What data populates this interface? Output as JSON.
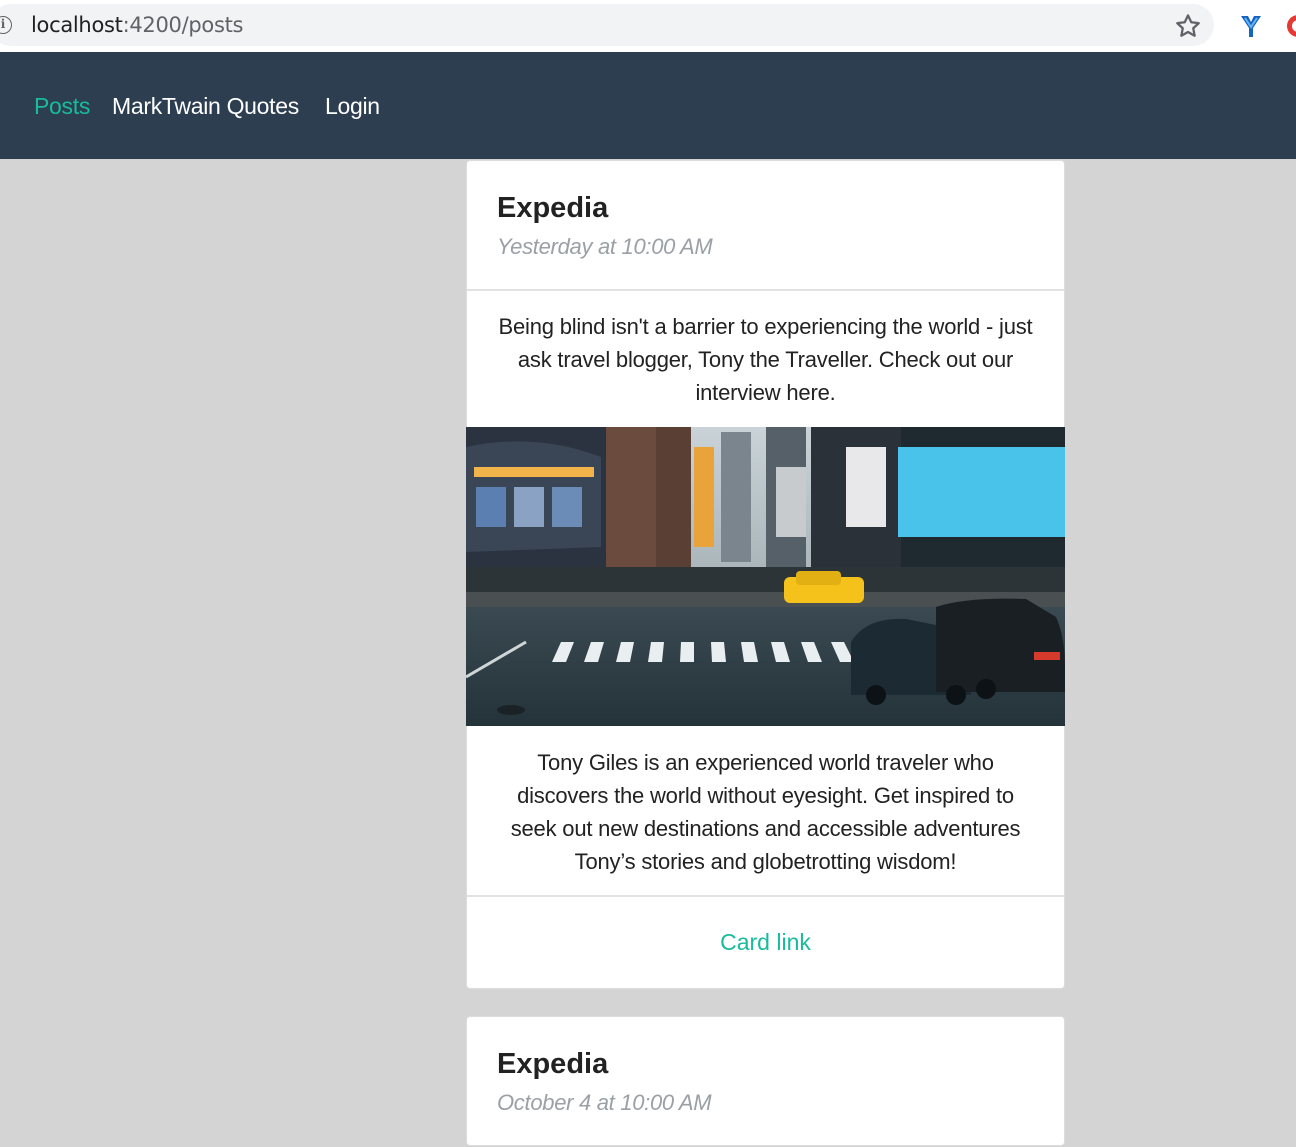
{
  "browser": {
    "url_host": "localhost",
    "url_path": ":4200/posts",
    "icons": [
      "info-icon",
      "star-icon",
      "extension-icon",
      "extension-icon"
    ]
  },
  "navbar": {
    "links": [
      {
        "label": "Posts",
        "active": true
      },
      {
        "label": "MarkTwain Quotes",
        "active": false
      },
      {
        "label": "Login",
        "active": false
      }
    ]
  },
  "posts": [
    {
      "title": "Expedia",
      "time": "Yesterday at 10:00 AM",
      "intro": "Being blind isn't a barrier to experiencing the world - just ask travel blogger, Tony the Traveller. Check out our interview here.",
      "image": "city-street-crosswalk-photo",
      "body": "Tony Giles is an experienced world traveler who discovers the world without eyesight. Get inspired to seek out new destinations and accessible adventures Tony’s stories and globetrotting wisdom!",
      "link": "Card link"
    },
    {
      "title": "Expedia",
      "time": "October 4 at 10:00 AM"
    }
  ],
  "colors": {
    "navbar_bg": "#2c3e50",
    "accent": "#18bc9c",
    "page_bg": "#d4d4d4"
  }
}
